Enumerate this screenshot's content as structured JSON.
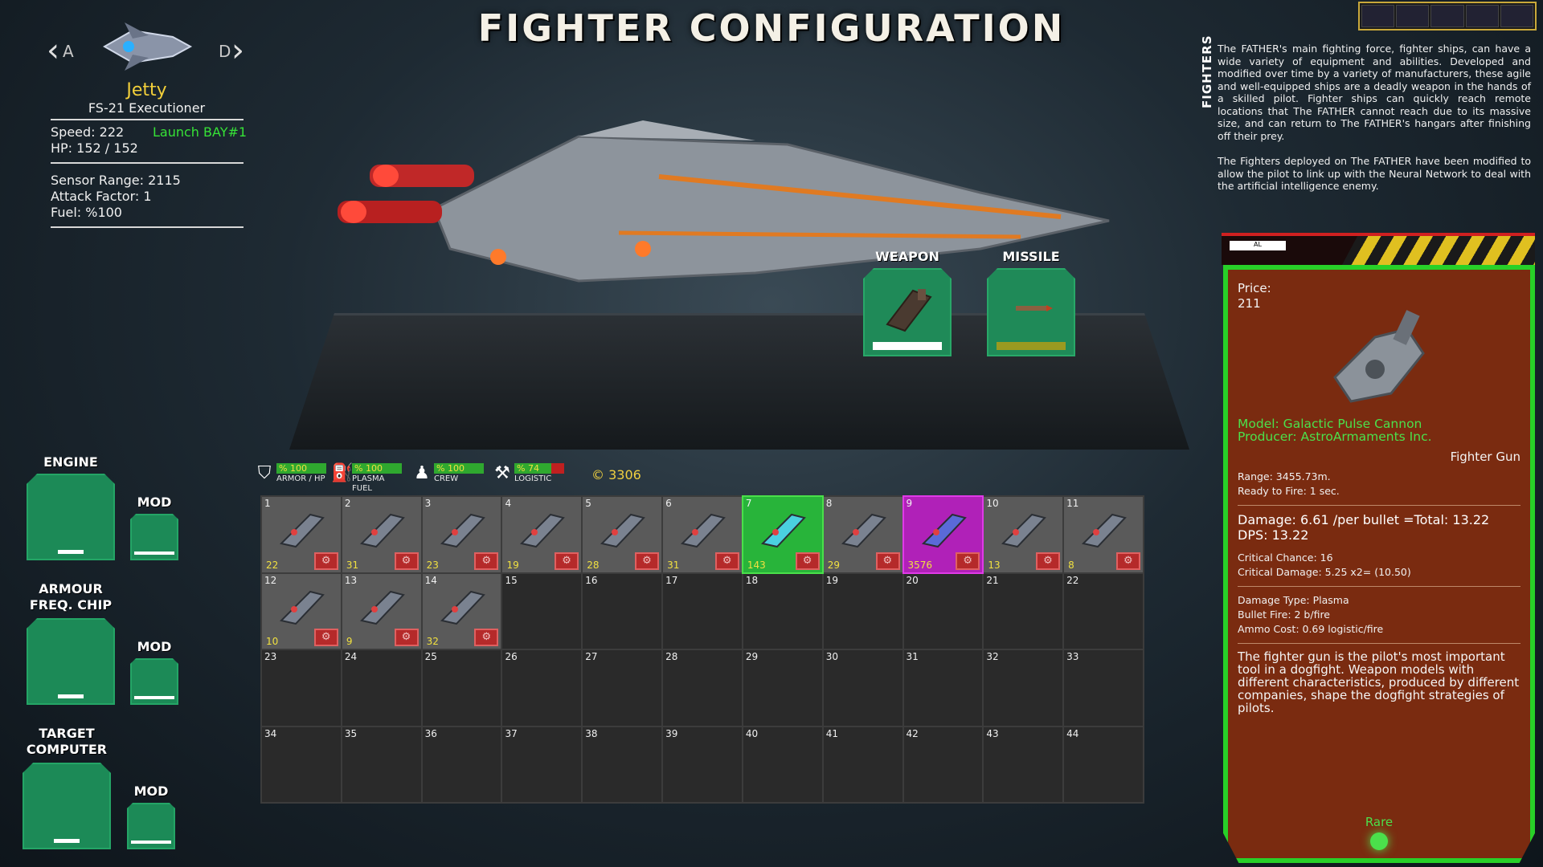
{
  "title": "FIGHTER CONFIGURATION",
  "ship_selector": {
    "prev_key": "A",
    "next_key": "D",
    "name": "Jetty",
    "model": "FS-21 Executioner",
    "speed": "Speed: 222",
    "launch_bay": "Launch BAY#1",
    "hp": "HP: 152 / 152",
    "sensor_range": "Sensor Range: 2115",
    "attack_factor": "Attack Factor: 1",
    "fuel": "Fuel: %100"
  },
  "description": {
    "label": "FIGHTERS",
    "paragraph1": "The FATHER's main fighting force, fighter ships, can have a wide variety of equipment and abilities. Developed and modified over time by a variety of manufacturers, these agile and well-equipped ships are a deadly weapon in the hands of a skilled pilot. Fighter ships can quickly reach remote locations that The FATHER cannot reach due to its massive size, and can return to The FATHER's hangars after finishing off their prey.",
    "paragraph2": "The Fighters deployed on The FATHER have been modified to allow the pilot to link up with the Neural Network to deal with the artificial intelligence enemy."
  },
  "top_slots": {
    "weapon_label": "WEAPON",
    "missile_label": "MISSILE",
    "weapon_bar_color": "#ffffff",
    "missile_bar_color": "#9a9a20"
  },
  "left_slots": {
    "engine": "ENGINE",
    "armour": "ARMOUR FREQ. CHIP",
    "target": "TARGET COMPUTER",
    "mod": "MOD"
  },
  "status": {
    "armor": {
      "value": "% 100",
      "label": "ARMOR / HP",
      "pct": 100
    },
    "fuel": {
      "value": "% 100",
      "label": "PLASMA FUEL",
      "pct": 100
    },
    "crew": {
      "value": "% 100",
      "label": "CREW",
      "pct": 100
    },
    "logistic": {
      "value": "% 74",
      "label": "LOGISTIC",
      "pct": 74
    },
    "credits": "3306"
  },
  "inventory": [
    {
      "n": "1",
      "q": "22",
      "item": true
    },
    {
      "n": "2",
      "q": "31",
      "item": true
    },
    {
      "n": "3",
      "q": "23",
      "item": true
    },
    {
      "n": "4",
      "q": "19",
      "item": true
    },
    {
      "n": "5",
      "q": "28",
      "item": true
    },
    {
      "n": "6",
      "q": "31",
      "item": true
    },
    {
      "n": "7",
      "q": "143",
      "item": true,
      "state": "sel"
    },
    {
      "n": "8",
      "q": "29",
      "item": true
    },
    {
      "n": "9",
      "q": "3576",
      "item": true,
      "state": "rare"
    },
    {
      "n": "10",
      "q": "13",
      "item": true
    },
    {
      "n": "11",
      "q": "8",
      "item": true
    },
    {
      "n": "12",
      "q": "10",
      "item": true
    },
    {
      "n": "13",
      "q": "9",
      "item": true
    },
    {
      "n": "14",
      "q": "32",
      "item": true
    },
    {
      "n": "15"
    },
    {
      "n": "16"
    },
    {
      "n": "17"
    },
    {
      "n": "18"
    },
    {
      "n": "19"
    },
    {
      "n": "20"
    },
    {
      "n": "21"
    },
    {
      "n": "22"
    },
    {
      "n": "23"
    },
    {
      "n": "24"
    },
    {
      "n": "25"
    },
    {
      "n": "26"
    },
    {
      "n": "27"
    },
    {
      "n": "28"
    },
    {
      "n": "29"
    },
    {
      "n": "30"
    },
    {
      "n": "31"
    },
    {
      "n": "32"
    },
    {
      "n": "33"
    },
    {
      "n": "34"
    },
    {
      "n": "35"
    },
    {
      "n": "36"
    },
    {
      "n": "37"
    },
    {
      "n": "38"
    },
    {
      "n": "39"
    },
    {
      "n": "40"
    },
    {
      "n": "41"
    },
    {
      "n": "42"
    },
    {
      "n": "43"
    },
    {
      "n": "44"
    }
  ],
  "item_panel": {
    "header_tag": "AL",
    "price_label": "Price:",
    "price": "211",
    "model": "Model: Galactic Pulse Cannon",
    "producer": "Producer: AstroArmaments Inc.",
    "category": "Fighter Gun",
    "range": "Range: 3455.73m.",
    "ready": "Ready to Fire: 1 sec.",
    "damage": "Damage: 6.61 /per bullet =Total: 13.22",
    "dps": "DPS: 13.22",
    "crit_chance": "Critical Chance: 16",
    "crit_damage": "Critical Damage: 5.25 x2= (10.50)",
    "damage_type": "Damage Type: Plasma",
    "bullet_fire": "Bullet Fire: 2 b/fire",
    "ammo_cost": "Ammo Cost: 0.69 logistic/fire",
    "flavor": "The fighter gun is the pilot's most important tool in a dogfight. Weapon models with different characteristics, produced by different companies, shape the dogfight strategies of pilots.",
    "rarity": "Rare"
  }
}
